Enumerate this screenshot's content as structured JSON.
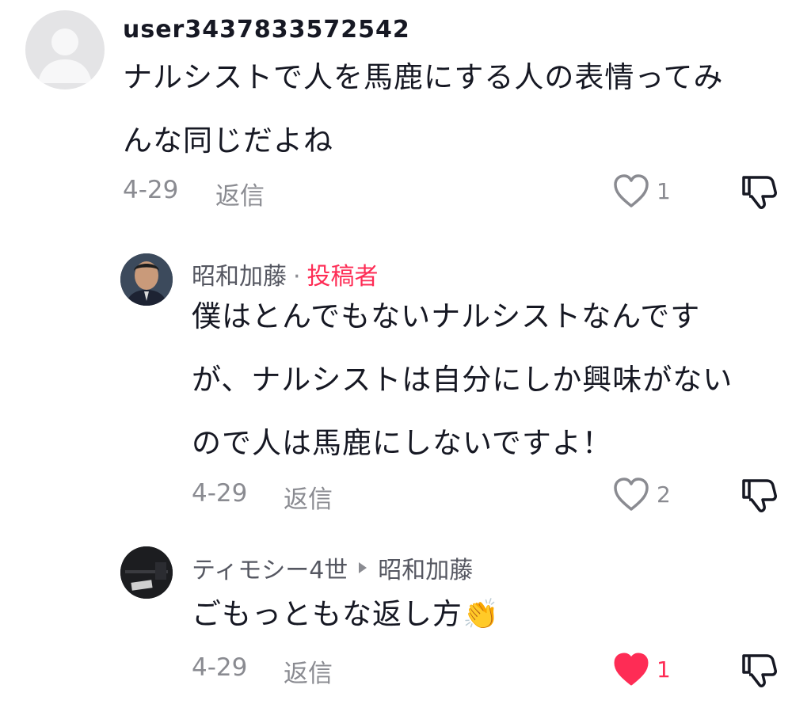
{
  "comments": [
    {
      "username": "user3437833572542",
      "text_line1": "ナルシストで人を馬鹿にする人の表情ってみ",
      "text_line2": "んな同じだよね",
      "date": "4-29",
      "reply_label": "返信",
      "likes": "1",
      "liked": false
    },
    {
      "username": "昭和加藤",
      "author_badge": "投稿者",
      "separator": "·",
      "text_line1": "僕はとんでもないナルシストなんです",
      "text_line2": "が、ナルシストは自分にしか興味がない",
      "text_line3": "ので人は馬鹿にしないですよ！",
      "date": "4-29",
      "reply_label": "返信",
      "likes": "2",
      "liked": false
    },
    {
      "username": "ティモシー4世",
      "reply_to": "昭和加藤",
      "text": "ごもっともな返し方",
      "emoji": "👏",
      "date": "4-29",
      "reply_label": "返信",
      "likes": "1",
      "liked": true
    }
  ],
  "colors": {
    "accent": "#fe2c55",
    "muted": "#8a8b91",
    "text": "#161823"
  },
  "icons": [
    "default-avatar-icon",
    "heart-icon",
    "heart-filled-icon",
    "dislike-icon",
    "reply-arrow-icon",
    "clap-emoji"
  ]
}
